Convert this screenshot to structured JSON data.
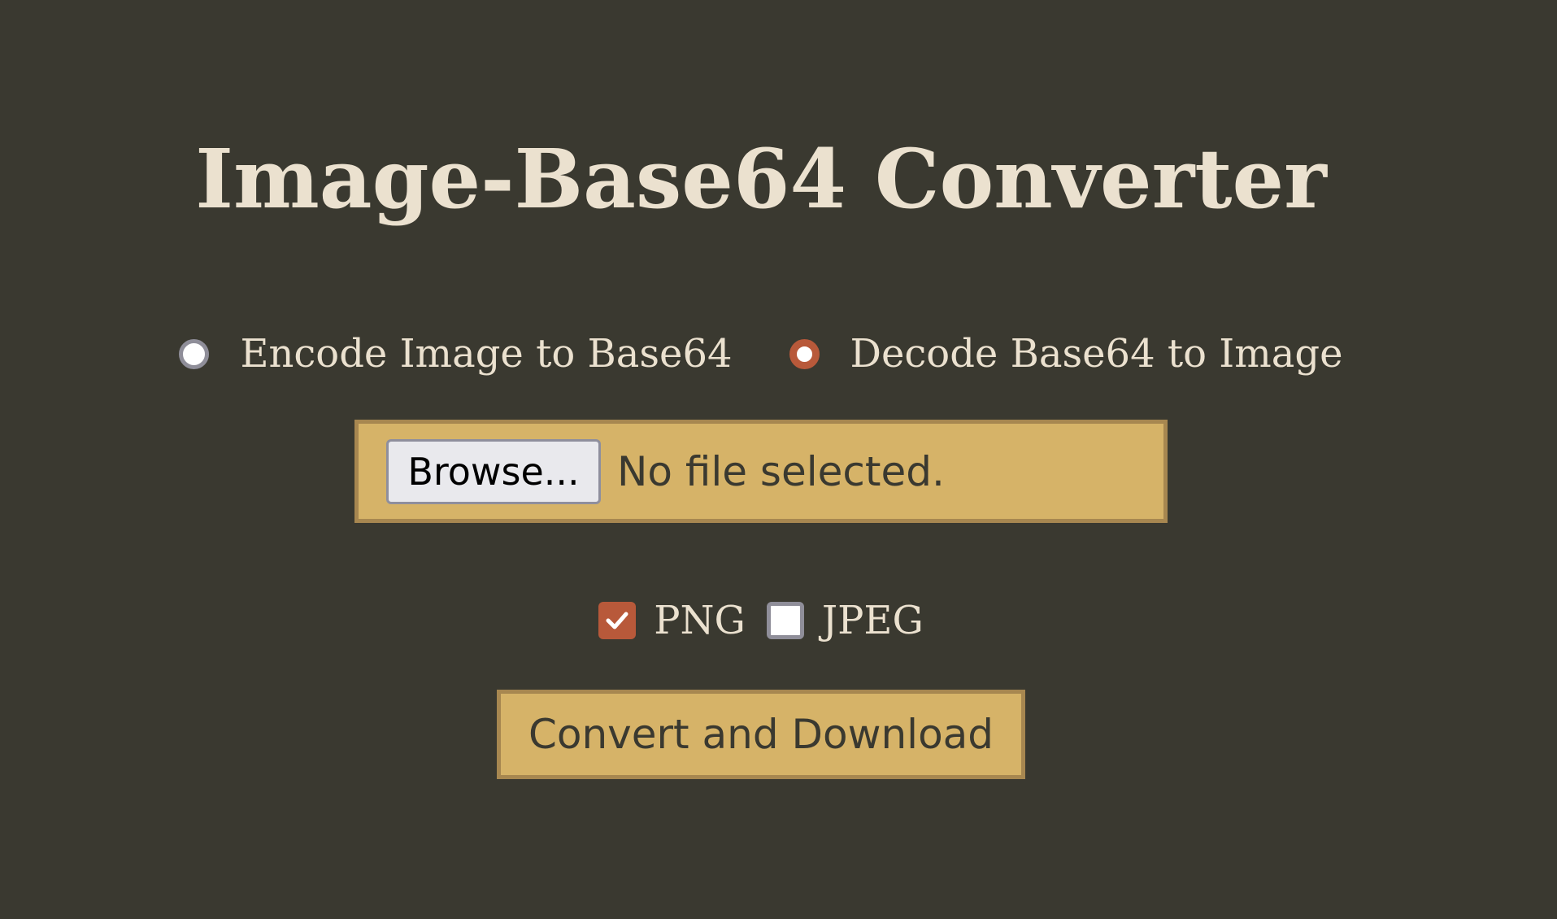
{
  "page": {
    "title": "Image-Base64 Converter"
  },
  "mode": {
    "options": [
      {
        "label": "Encode Image to Base64",
        "checked": false
      },
      {
        "label": "Decode Base64 to Image",
        "checked": true
      }
    ]
  },
  "file_input": {
    "button_label": "Browse...",
    "status": "No file selected."
  },
  "formats": {
    "options": [
      {
        "label": "PNG",
        "checked": true
      },
      {
        "label": "JPEG",
        "checked": false
      }
    ]
  },
  "actions": {
    "convert_label": "Convert and Download"
  },
  "colors": {
    "background": "#3a3930",
    "text_light": "#ebe1cf",
    "accent": "#b8593a",
    "panel": "#d6b368",
    "panel_border": "#a78750"
  }
}
